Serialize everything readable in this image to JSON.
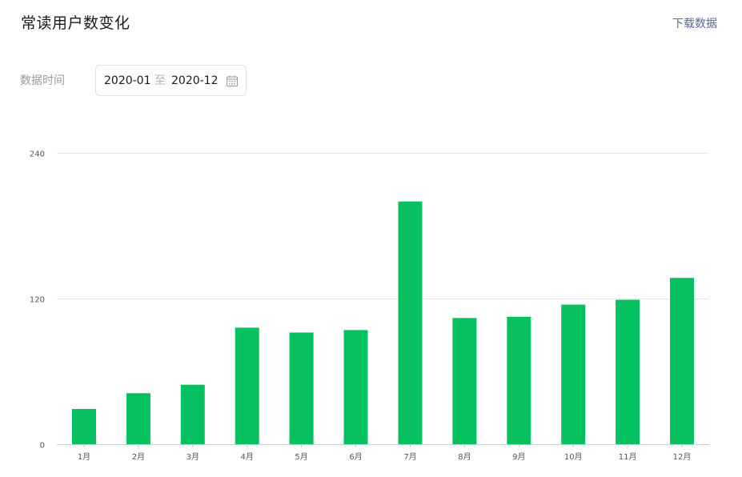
{
  "header": {
    "title": "常读用户数变化",
    "download_label": "下载数据"
  },
  "filter": {
    "label": "数据时间",
    "start": "2020-01",
    "separator": "至",
    "end": "2020-12",
    "icon": "calendar-icon"
  },
  "colors": {
    "bar": "#07c160",
    "grid": "#e6e6e6",
    "axis": "#cccccc",
    "link": "#576b95"
  },
  "chart_data": {
    "type": "bar",
    "categories": [
      "1月",
      "2月",
      "3月",
      "4月",
      "5月",
      "6月",
      "7月",
      "8月",
      "9月",
      "10月",
      "11月",
      "12月"
    ],
    "values": [
      29,
      42,
      49,
      96,
      92,
      94,
      200,
      104,
      105,
      115,
      119,
      137
    ],
    "ylim": [
      0,
      240
    ],
    "yticks": [
      0,
      120,
      240
    ],
    "title": "",
    "xlabel": "",
    "ylabel": "",
    "grid": true,
    "legend": "none"
  }
}
